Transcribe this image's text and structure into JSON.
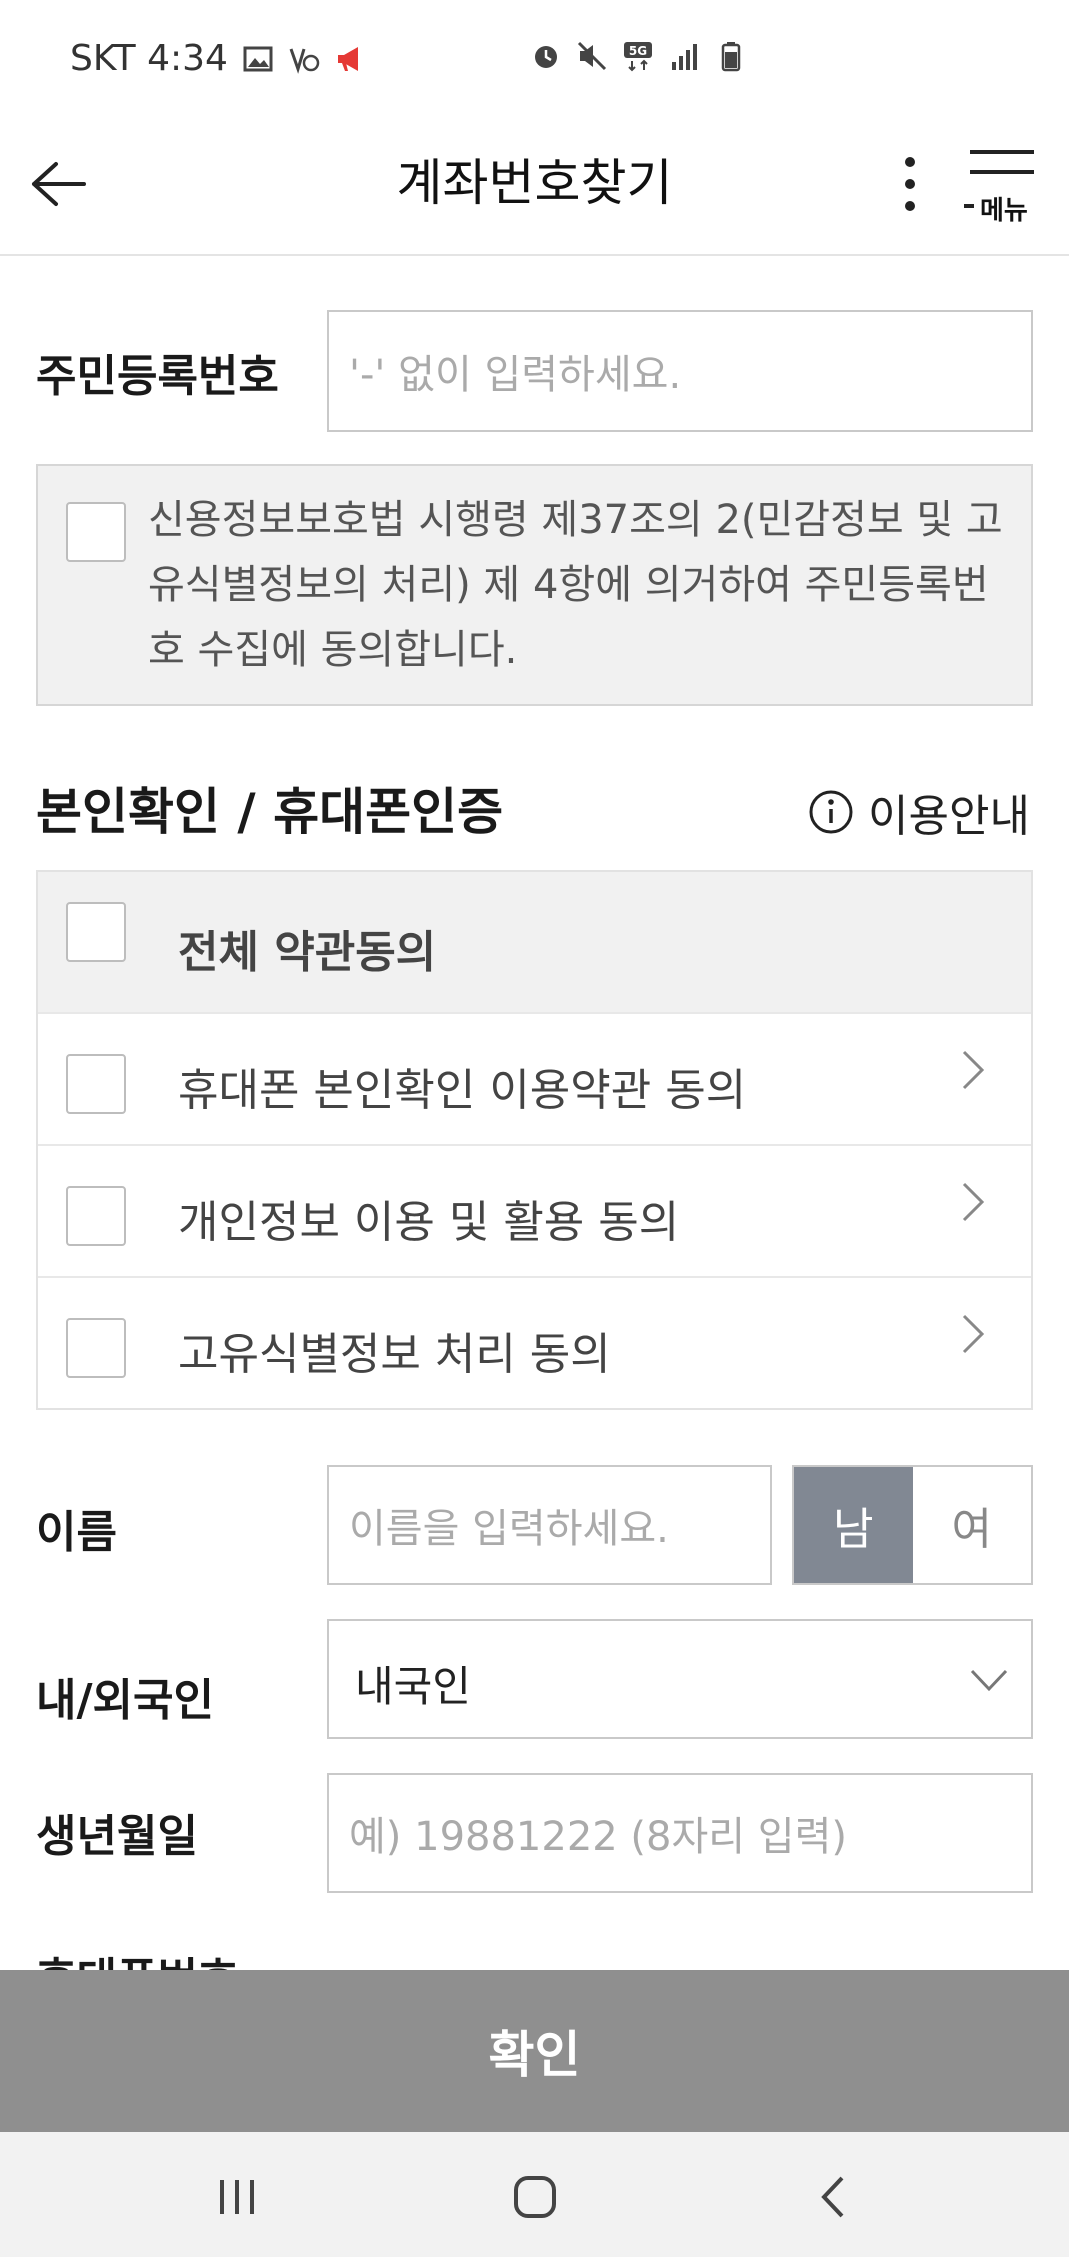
{
  "status_bar": {
    "carrier_time": "SKT 4:34",
    "left_icons": [
      "gallery-icon",
      "volte-icon",
      "megaphone-icon"
    ],
    "right_icons": [
      "alarm-icon",
      "mute-icon",
      "5g-icon",
      "signal-icon",
      "battery-icon"
    ]
  },
  "header": {
    "title": "계좌번호찾기",
    "menu_label": "메뉴"
  },
  "resident_number": {
    "label": "주민등록번호",
    "placeholder": "'-' 없이 입력하세요."
  },
  "consent": {
    "text": "신용정보보호법 시행령 제37조의 2(민감정보 및 고유식별정보의 처리) 제 4항에 의거하여 주민등록번호 수집에 동의합니다."
  },
  "verification": {
    "title": "본인확인 / 휴대폰인증",
    "info_label": "이용안내",
    "all_agree": "전체 약관동의",
    "terms": [
      {
        "label": "휴대폰 본인확인 이용약관 동의"
      },
      {
        "label": "개인정보 이용 및 활용 동의"
      },
      {
        "label": "고유식별정보 처리 동의"
      }
    ]
  },
  "name": {
    "label": "이름",
    "placeholder": "이름을 입력하세요.",
    "gender_male": "남",
    "gender_female": "여",
    "selected_gender": "남"
  },
  "nationality": {
    "label": "내/외국인",
    "value": "내국인"
  },
  "birthdate": {
    "label": "생년월일",
    "placeholder": "예) 19881222 (8자리 입력)"
  },
  "phone": {
    "label": "휴대폰번호"
  },
  "confirm_label": "확인",
  "colors": {
    "gender_active": "#818893",
    "confirm_bar": "#8f8f8f",
    "consent_bg": "#f1f1f1"
  }
}
